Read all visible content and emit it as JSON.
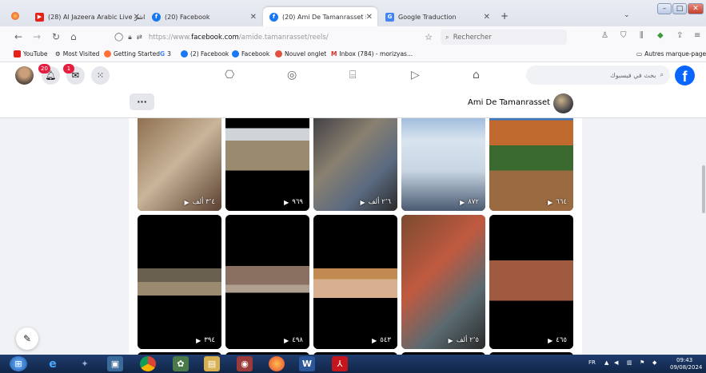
{
  "browser": {
    "tabs": [
      {
        "label": "(28) Al Jazeera Arabic Live قناة الجزيرة مباشر",
        "color": "#e62117",
        "glyph": "▶"
      },
      {
        "label": "(20) Facebook",
        "color": "#1877f2",
        "glyph": "f"
      },
      {
        "label": "(20) Ami De Tamanrasset Reels",
        "color": "#1877f2",
        "glyph": "f",
        "active": true
      },
      {
        "label": "Google Traduction",
        "color": "#4285f4",
        "glyph": "G"
      }
    ],
    "new_tab": "+",
    "url_prefix": "https://www.",
    "url_domain": "facebook.com",
    "url_path": "/amide.tamanrasset/reels/",
    "search_placeholder": "Rechercher",
    "bookmarks": [
      {
        "label": "YouTube",
        "color": "#e62117"
      },
      {
        "label": "Most Visited",
        "color": "#777777"
      },
      {
        "label": "Getting Started",
        "color": "#ff7139"
      },
      {
        "label": "3",
        "color": "#4285f4",
        "prefix": "G"
      },
      {
        "label": "(2) Facebook",
        "color": "#1877f2"
      },
      {
        "label": "Facebook",
        "color": "#1877f2"
      },
      {
        "label": "Nouvel onglet",
        "color": "#e0523d"
      },
      {
        "label": "Inbox (784) - morizyas...",
        "color": "#d93025",
        "prefix": "M"
      }
    ],
    "other_bookmarks": "Autres marque-pages"
  },
  "facebook": {
    "notifications_badge": "20",
    "messenger_badge": "1",
    "search_placeholder": "بحث في فيسبوك",
    "profile_name": "Ami De Tamanrasset",
    "more_label": "···"
  },
  "reels": [
    {
      "count": "٣٬٤ ألف",
      "bg": "linear-gradient(135deg,#8a6a4a,#c9b59a 50%,#5a4030)"
    },
    {
      "count": "٩٦٩",
      "bg": "linear-gradient(#000 0 18%, #cfd4d8 18% 30%, #9a8a70 30% 60%, #000 60%)"
    },
    {
      "count": "٢٬٦ ألف",
      "bg": "linear-gradient(135deg,#3a3a40,#8a8070 40%,#5a6a80 70%,#2a2a2a)"
    },
    {
      "count": "٨٧٢",
      "bg": "linear-gradient(#8fb0d8, #d8e4ee 30%, #c8d6e4 60%, #4a5a70)"
    },
    {
      "count": "٦٦٤",
      "bg": "linear-gradient(#3a78c0 0 10%, #c06a30 10% 35%, #3a6a30 35% 60%, #9a6a40 60%)"
    },
    {
      "count": "٣٩٤",
      "bg": "linear-gradient(#000 0 40%, #6a6050 40% 50%, #9a8a70 50% 60%, #000 60%)"
    },
    {
      "count": "٤٩٨",
      "bg": "linear-gradient(#000 0 38%, #8a7060 38% 52%, #b0a090 52% 58%, #000 58%)"
    },
    {
      "count": "٥٤٣",
      "bg": "linear-gradient(#000 0 40%, #c08a50 40% 48%, #d8b090 48% 62%, #000 62%)"
    },
    {
      "count": "٢٬٥ ألف",
      "bg": "linear-gradient(135deg,#7a4a30,#c05a40 40%,#5a6a70 70%,#2a2a2a)"
    },
    {
      "count": "٤٦٥",
      "bg": "linear-gradient(#000 0 34%, #a05a40 34% 64%, #000 64%)"
    }
  ],
  "taskbar": {
    "lang": "FR",
    "time": "09:43",
    "date": "09/08/2024"
  }
}
